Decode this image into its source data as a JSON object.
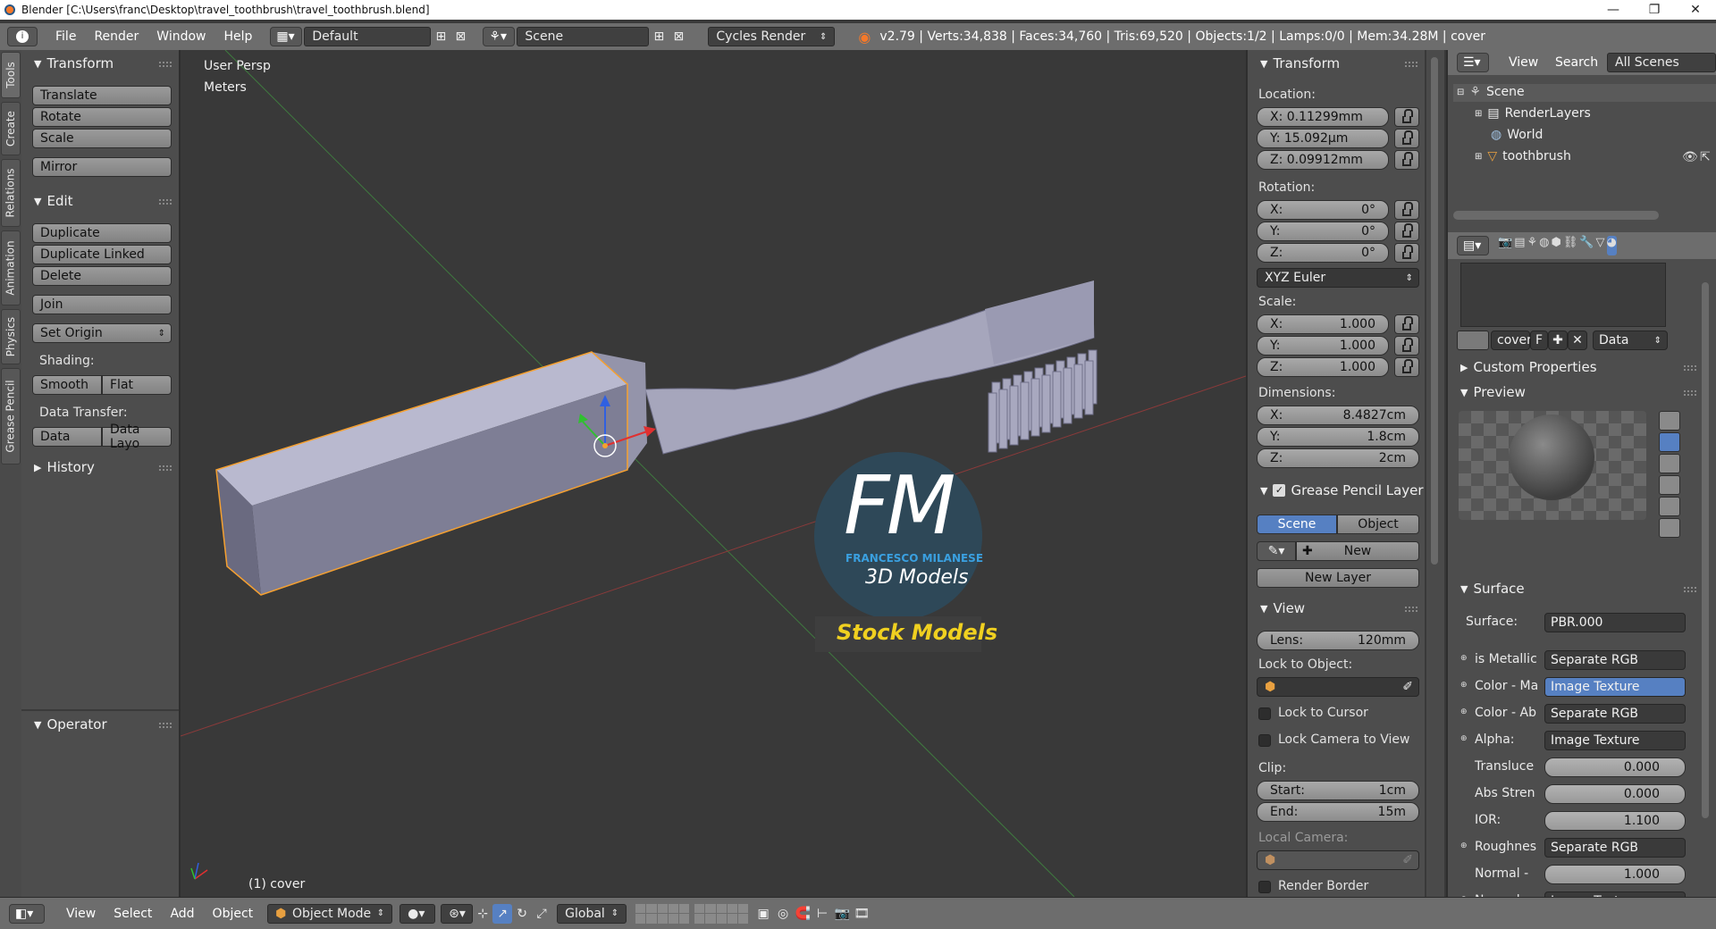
{
  "window": {
    "title": "Blender [C:\\Users\\franc\\Desktop\\travel_toothbrush\\travel_toothbrush.blend]",
    "controls": [
      "—",
      "❐",
      "✕"
    ]
  },
  "infobar": {
    "menus": [
      "File",
      "Render",
      "Window",
      "Help"
    ],
    "screen_layout": "Default",
    "scene": "Scene",
    "engine": "Cycles Render",
    "stats": "v2.79 | Verts:34,838 | Faces:34,760 | Tris:69,520 | Objects:1/2 | Lamps:0/0 | Mem:34.28M | cover"
  },
  "tabs": [
    "Tools",
    "Create",
    "Relations",
    "Animation",
    "Physics",
    "Grease Pencil"
  ],
  "toolshelf": {
    "transform_title": "Transform",
    "translate": "Translate",
    "rotate": "Rotate",
    "scale": "Scale",
    "mirror": "Mirror",
    "edit_title": "Edit",
    "duplicate": "Duplicate",
    "duplicate_linked": "Duplicate Linked",
    "delete": "Delete",
    "join": "Join",
    "set_origin": "Set Origin",
    "shading_label": "Shading:",
    "smooth": "Smooth",
    "flat": "Flat",
    "data_transfer_label": "Data Transfer:",
    "data": "Data",
    "data_layo": "Data Layo",
    "history_title": "History",
    "operator_title": "Operator"
  },
  "viewport": {
    "view_name": "User Persp",
    "units": "Meters",
    "object_label": "(1) cover",
    "watermark_letters": "FM",
    "watermark_name": "FRANCESCO MILANESE",
    "watermark_sub": "3D Models",
    "watermark_banner": "Stock Models"
  },
  "npanel": {
    "transform_title": "Transform",
    "location_label": "Location:",
    "loc_x": "X:  0.11299mm",
    "loc_y": "Y:     15.092µm",
    "loc_z": "Z:  0.09912mm",
    "rotation_label": "Rotation:",
    "rot_x_l": "X:",
    "rot_x_v": "0°",
    "rot_y_l": "Y:",
    "rot_y_v": "0°",
    "rot_z_l": "Z:",
    "rot_z_v": "0°",
    "rotation_mode": "XYZ Euler",
    "scale_label": "Scale:",
    "scale_x_l": "X:",
    "scale_x_v": "1.000",
    "scale_y_l": "Y:",
    "scale_y_v": "1.000",
    "scale_z_l": "Z:",
    "scale_z_v": "1.000",
    "dimensions_label": "Dimensions:",
    "dim_x_l": "X:",
    "dim_x_v": "8.4827cm",
    "dim_y_l": "Y:",
    "dim_y_v": "1.8cm",
    "dim_z_l": "Z:",
    "dim_z_v": "2cm",
    "gp_title": "Grease Pencil Layer",
    "gp_scene": "Scene",
    "gp_object": "Object",
    "gp_new": "New",
    "gp_new_layer": "New Layer",
    "view_title": "View",
    "lens_l": "Lens:",
    "lens_v": "120mm",
    "lock_to_object": "Lock to Object:",
    "lock_to_cursor": "Lock to Cursor",
    "lock_camera": "Lock Camera to View",
    "clip_label": "Clip:",
    "clip_start_l": "Start:",
    "clip_start_v": "1cm",
    "clip_end_l": "End:",
    "clip_end_v": "15m",
    "local_camera": "Local Camera:",
    "render_border": "Render Border"
  },
  "outliner": {
    "view": "View",
    "search": "Search",
    "filter": "All Scenes",
    "items": [
      "Scene",
      "RenderLayers",
      "World",
      "toothbrush"
    ]
  },
  "properties": {
    "material_name": "cover",
    "fake_user": "F",
    "link": "Data",
    "custom_props": "Custom Properties",
    "preview": "Preview",
    "surface_title": "Surface",
    "surface_l": "Surface:",
    "surface_v": "PBR.000",
    "metallic_l": "is Metallic",
    "metallic_v": "Separate RGB",
    "colorma_l": "Color - Ma",
    "colorma_v": "Image Texture",
    "colorab_l": "Color - Ab",
    "colorab_v": "Separate RGB",
    "alpha_l": "Alpha:",
    "alpha_v": "Image Texture",
    "transluce_l": "Transluce",
    "transluce_v": "0.000",
    "absstren_l": "Abs Stren",
    "absstren_v": "0.000",
    "ior_l": "IOR:",
    "ior_v": "1.100",
    "roughnes_l": "Roughnes",
    "roughnes_v": "Separate RGB",
    "normal1_l": "Normal -",
    "normal1_v": "1.000",
    "normal2_l": "Normal -",
    "normal2_v": "Image Texture"
  },
  "bottombar": {
    "menus": [
      "View",
      "Select",
      "Add",
      "Object"
    ],
    "mode": "Object Mode",
    "orientation": "Global"
  },
  "colors": {
    "accent_blue": "#5680c2",
    "selection_orange": "#f5a030",
    "watermark_yellow": "#f0d020",
    "watermark_blue": "#3aa0e0"
  }
}
